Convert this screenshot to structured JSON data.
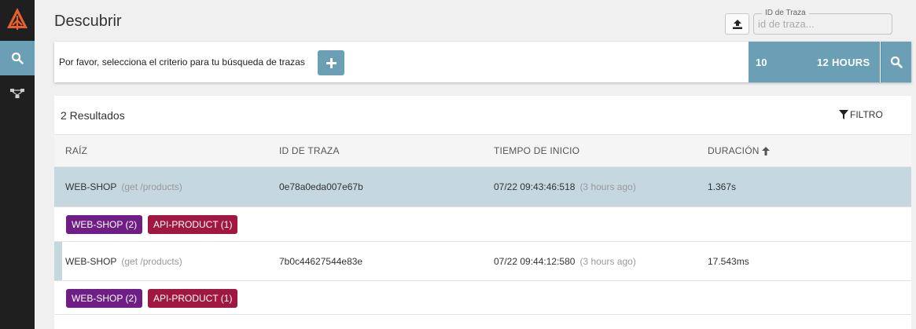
{
  "header": {
    "title": "Descubrir"
  },
  "trace_search": {
    "label": "ID de Traza",
    "placeholder": "id de traza..."
  },
  "search": {
    "prompt": "Por favor, selecciona el criterio para tu búsqueda de trazas",
    "add_label": "+",
    "limit": "10",
    "lookback": "12 HOURS"
  },
  "results": {
    "count_label": "2 Resultados",
    "filter_label": "FILTRO",
    "columns": {
      "root": "RAÍZ",
      "trace_id": "ID DE TRAZA",
      "start_time": "TIEMPO DE INICIO",
      "duration": "DURACIÓN"
    },
    "rows": [
      {
        "service": "WEB-SHOP",
        "span": "(get /products)",
        "trace_id": "0e78a0eda007e67b",
        "start": "07/22 09:43:46:518",
        "ago": "(3 hours ago)",
        "duration": "1.367s",
        "tags": [
          {
            "label": "WEB-SHOP (2)",
            "color": "#6f1e86"
          },
          {
            "label": "API-PRODUCT (1)",
            "color": "#a0173f"
          }
        ]
      },
      {
        "service": "WEB-SHOP",
        "span": "(get /products)",
        "trace_id": "7b0c44627544e83e",
        "start": "07/22 09:44:12:580",
        "ago": "(3 hours ago)",
        "duration": "17.543ms",
        "tags": [
          {
            "label": "WEB-SHOP (2)",
            "color": "#6f1e86"
          },
          {
            "label": "API-PRODUCT (1)",
            "color": "#a0173f"
          }
        ]
      }
    ]
  },
  "colors": {
    "accent": "#6a9fb5",
    "sidebar": "#1f1f1f",
    "logo": "#e8602c",
    "selected_row": "#c5d8e0"
  }
}
